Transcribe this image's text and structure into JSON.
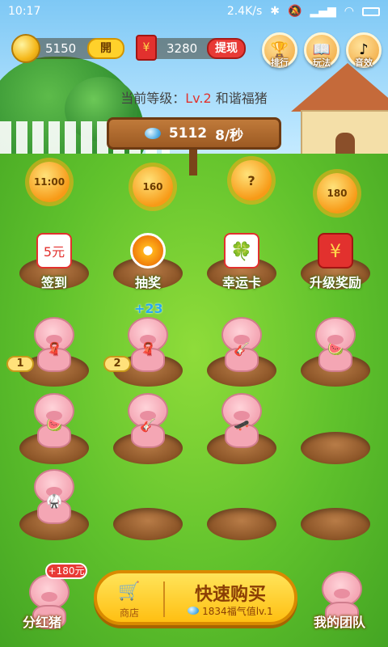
{
  "status_bar": {
    "time": "10:17",
    "network_speed": "2.4K/s"
  },
  "header": {
    "coins": "5150",
    "open_button": "開",
    "red_envelope_value": "3280",
    "withdraw_button": "提现",
    "icons": [
      {
        "name": "trophy-icon",
        "label": "排行"
      },
      {
        "name": "book-icon",
        "label": "玩法"
      },
      {
        "name": "music-icon",
        "label": "音效"
      }
    ]
  },
  "level": {
    "prefix": "当前等级：",
    "level_value": "Lv.2",
    "suffix": "和谐福猪"
  },
  "sign": {
    "value": "5112",
    "rate": "8/秒"
  },
  "suns": [
    "11:00",
    "160",
    "?",
    "180"
  ],
  "features": [
    {
      "name": "sign-in",
      "label": "签到",
      "icon_text": "5元"
    },
    {
      "name": "lottery",
      "label": "抽奖",
      "icon_text": ""
    },
    {
      "name": "lucky-card",
      "label": "幸运卡",
      "icon_text": "🍀"
    },
    {
      "name": "upgrade-reward",
      "label": "升级奖励",
      "icon_text": "¥"
    }
  ],
  "pigs": {
    "gain_text": "+23",
    "badges": [
      "1",
      "2"
    ]
  },
  "bottom": {
    "left_bubble": "+180元",
    "left_label": "分红猪",
    "shop_label": "商店",
    "buy_title": "快速购买",
    "buy_subtitle": "1834福气值lv.1",
    "right_label": "我的团队"
  }
}
